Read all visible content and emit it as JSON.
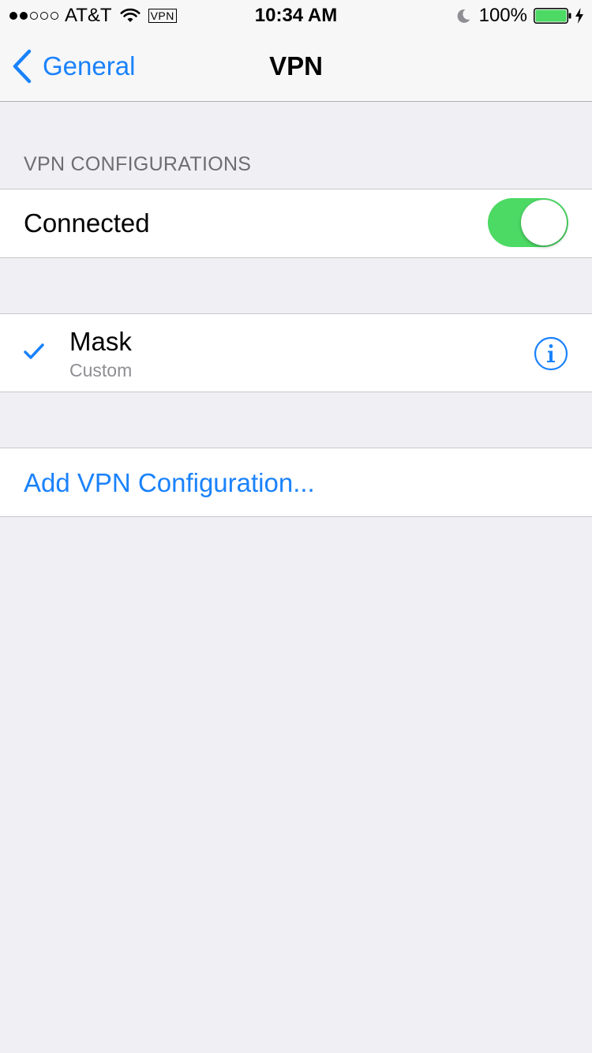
{
  "status_bar": {
    "signal_filled": 2,
    "signal_total": 5,
    "carrier": "AT&T",
    "wifi_icon": "wifi-icon",
    "vpn_badge": "VPN",
    "time": "10:34 AM",
    "moon_icon": "moon-icon",
    "battery_percent": "100%",
    "battery_level": 1.0,
    "battery_color": "#4cd964",
    "charging_icon": "bolt-icon"
  },
  "nav": {
    "back_label": "General",
    "back_icon": "chevron-left-icon",
    "title": "VPN"
  },
  "section": {
    "header": "VPN CONFIGURATIONS",
    "connected_label": "Connected",
    "toggle_on": true
  },
  "configurations": [
    {
      "name": "Mask",
      "type": "Custom",
      "selected": true,
      "info_icon": "info-icon"
    }
  ],
  "add_configuration_label": "Add VPN Configuration...",
  "colors": {
    "accent": "#1a82fb",
    "toggle_on": "#4cd964",
    "background": "#efeff4",
    "secondary_text": "#8e8e93",
    "section_header": "#6d6d72"
  }
}
